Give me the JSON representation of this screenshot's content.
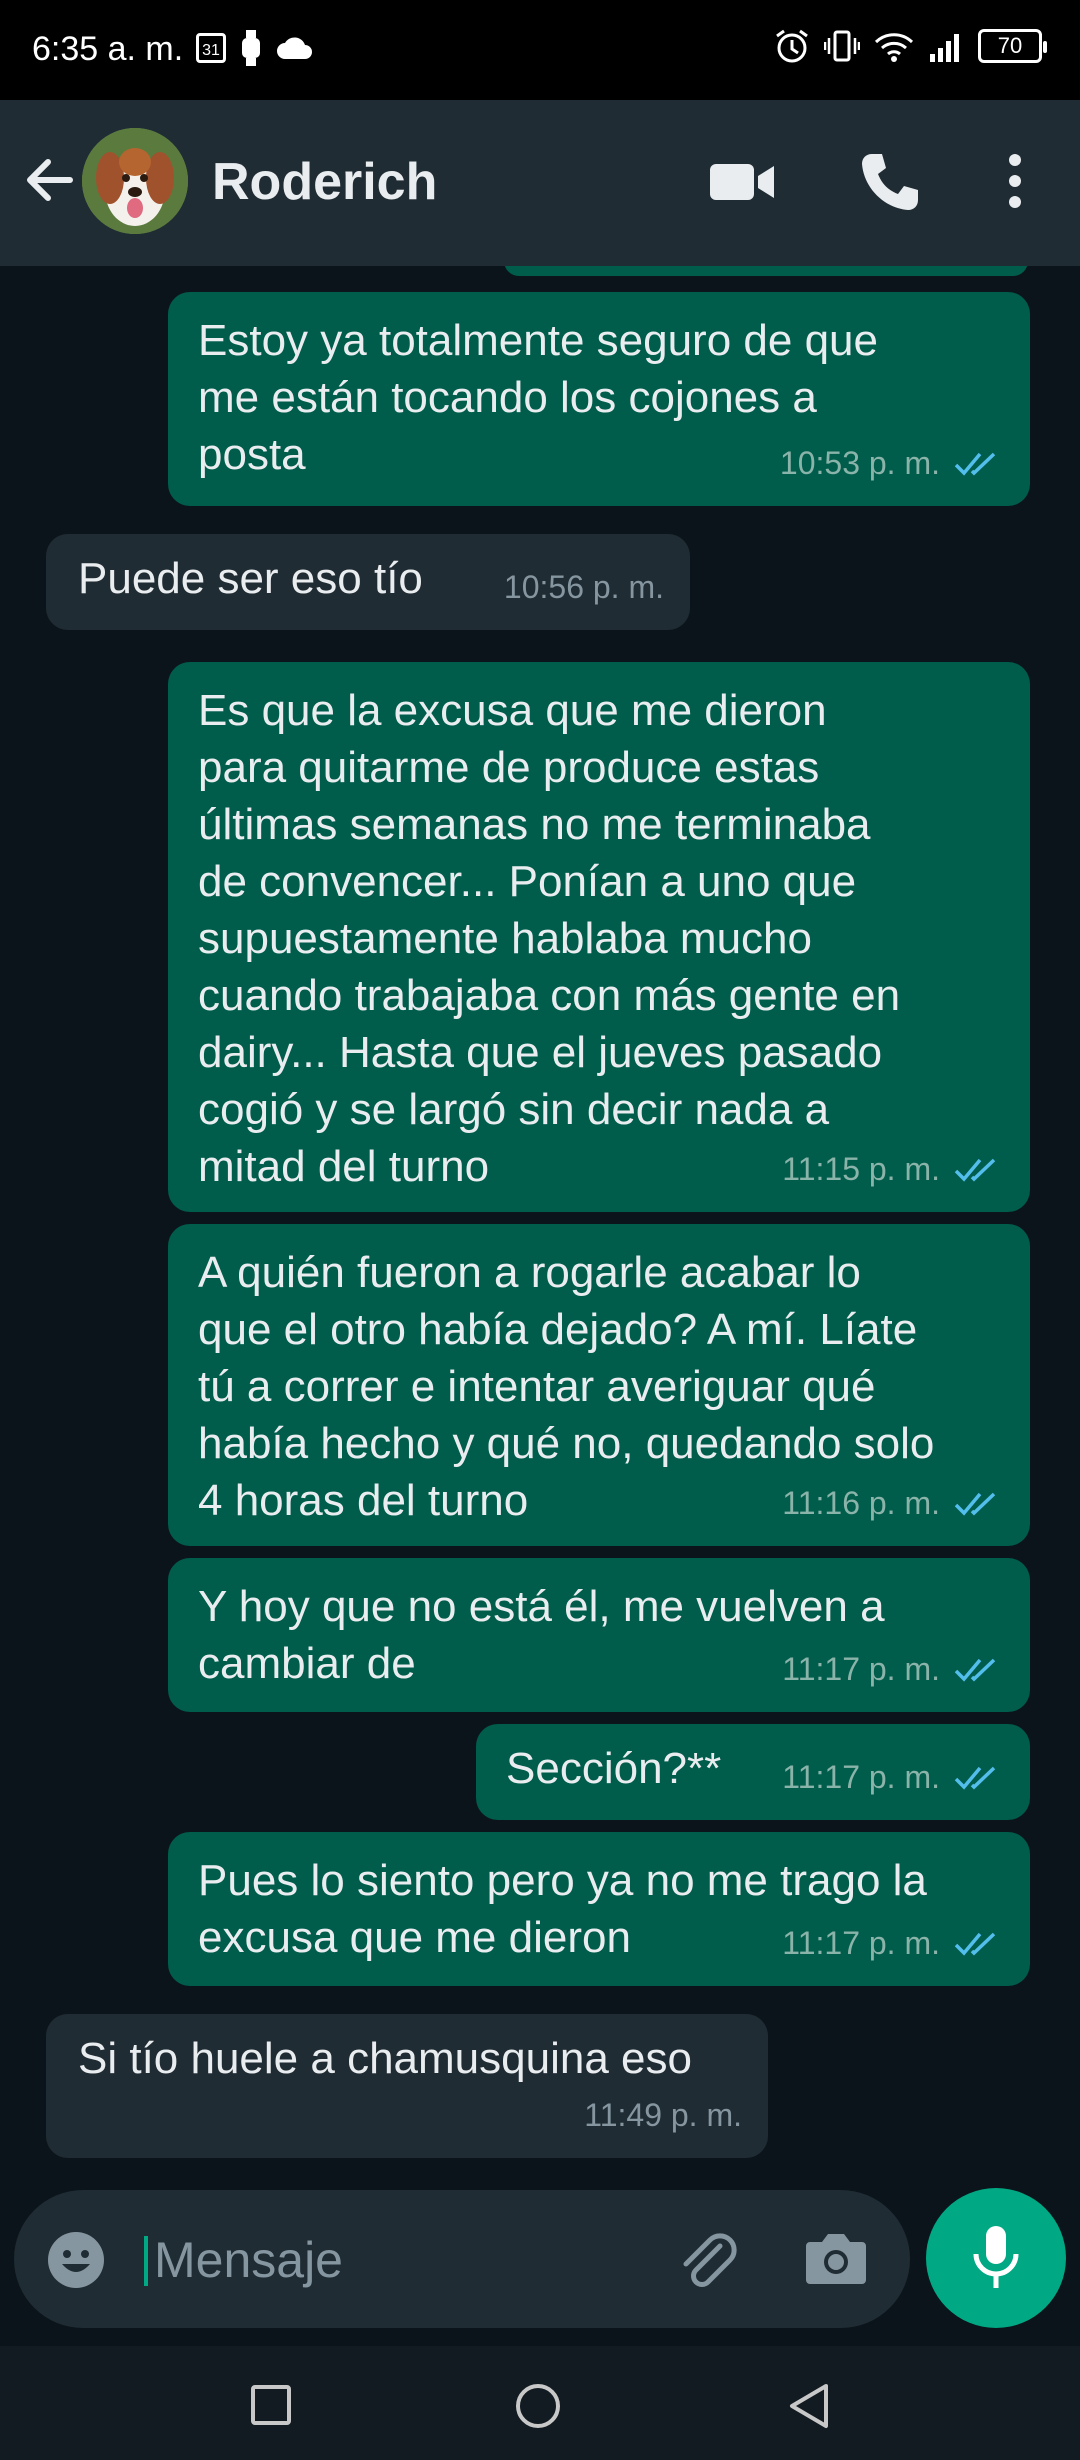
{
  "status_bar": {
    "time": "6:35 a. m.",
    "calendar_day": "31",
    "battery": "70"
  },
  "header": {
    "contact_name": "Roderich"
  },
  "messages": [
    {
      "direction": "out",
      "text": "Estoy ya totalmente seguro de que\nme están tocando los cojones a\nposta",
      "time": "10:53 p. m.",
      "read": true
    },
    {
      "direction": "in",
      "text": "Puede ser eso tío",
      "time": "10:56 p. m."
    },
    {
      "direction": "out",
      "text": "Es que la excusa que me dieron\npara quitarme de produce estas\núltimas semanas no me terminaba\nde convencer... Ponían a uno que\nsupuestamente hablaba mucho\ncuando trabajaba con más gente en\ndairy... Hasta que el jueves pasado\ncogió y se largó sin decir nada a\nmitad del turno",
      "time": "11:15 p. m.",
      "read": true
    },
    {
      "direction": "out",
      "text": "A quién fueron a rogarle acabar lo\nque el otro había dejado? A mí. Líate\ntú a correr e intentar averiguar qué\nhabía hecho y qué no, quedando solo\n4 horas del turno",
      "time": "11:16 p. m.",
      "read": true
    },
    {
      "direction": "out",
      "text": "Y hoy que no está él, me vuelven a\ncambiar de",
      "time": "11:17 p. m.",
      "read": true
    },
    {
      "direction": "out",
      "text": "Sección?**",
      "time": "11:17 p. m.",
      "read": true
    },
    {
      "direction": "out",
      "text": "Pues lo siento pero ya no me trago la\nexcusa que me dieron",
      "time": "11:17 p. m.",
      "read": true
    },
    {
      "direction": "in",
      "text": "Si tío huele a chamusquina eso",
      "time": "11:49 p. m."
    }
  ],
  "composer": {
    "placeholder": "Mensaje"
  },
  "colors": {
    "outgoing_bubble": "#005c4b",
    "incoming_bubble": "#202c33",
    "accent": "#00a884",
    "read_ticks": "#53bdeb"
  }
}
